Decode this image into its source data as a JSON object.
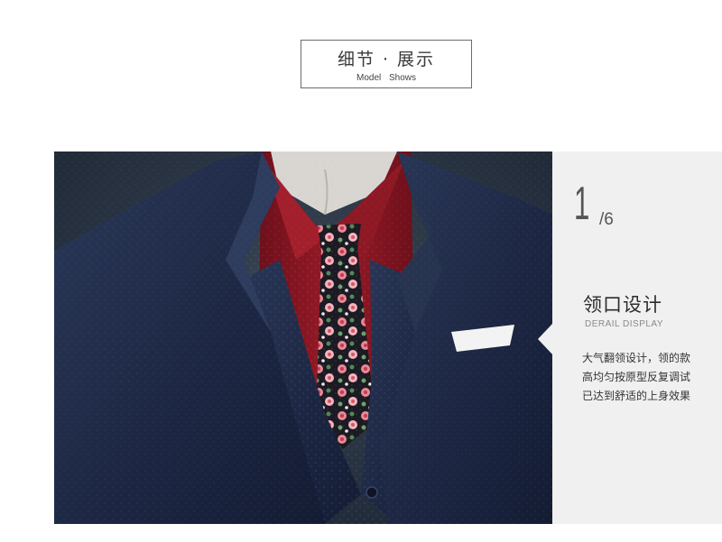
{
  "header": {
    "title": "细节 · 展示",
    "subtitle": "Model Shows"
  },
  "detail_panel": {
    "page_current": "1",
    "page_total": "/6",
    "title": "领口设计",
    "subtitle": "DERAIL DISPLAY",
    "description_lines": [
      "大气翻领设计，领的款",
      "高均匀按原型反复调试",
      "已达到舒适的上身效果"
    ]
  },
  "colors": {
    "suit_navy": "#1f2c48",
    "shirt_red": "#8a1522",
    "panel_bg": "#f0f0f0",
    "backdrop": "#25313f"
  }
}
